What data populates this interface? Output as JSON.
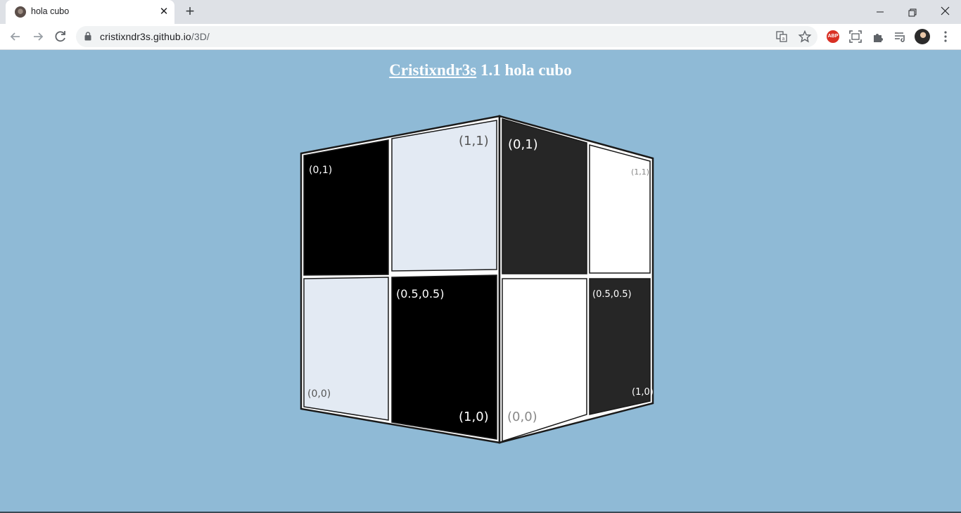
{
  "browser": {
    "tab_title": "hola cubo",
    "tab_close": "✕",
    "new_tab": "+",
    "url_host": "cristixndr3s.github.io",
    "url_path": "/3D/",
    "abp_label": "ABP"
  },
  "page": {
    "heading_link": "Cristixndr3s",
    "heading_rest": " 1.1 hola cubo",
    "background": "#8fbad6"
  },
  "cube": {
    "left_face": {
      "top_left": "(0,1)",
      "top_right": "(1,1)",
      "mid": "(0.5,0.5)",
      "bottom_left": "(0,0)",
      "bottom_right": "(1,0)"
    },
    "right_face": {
      "top_left": "(0,1)",
      "top_right": "(1,1)",
      "mid": "(0.5,0.5)",
      "bottom_left": "(0,0)",
      "bottom_right": "(1,0)"
    }
  }
}
